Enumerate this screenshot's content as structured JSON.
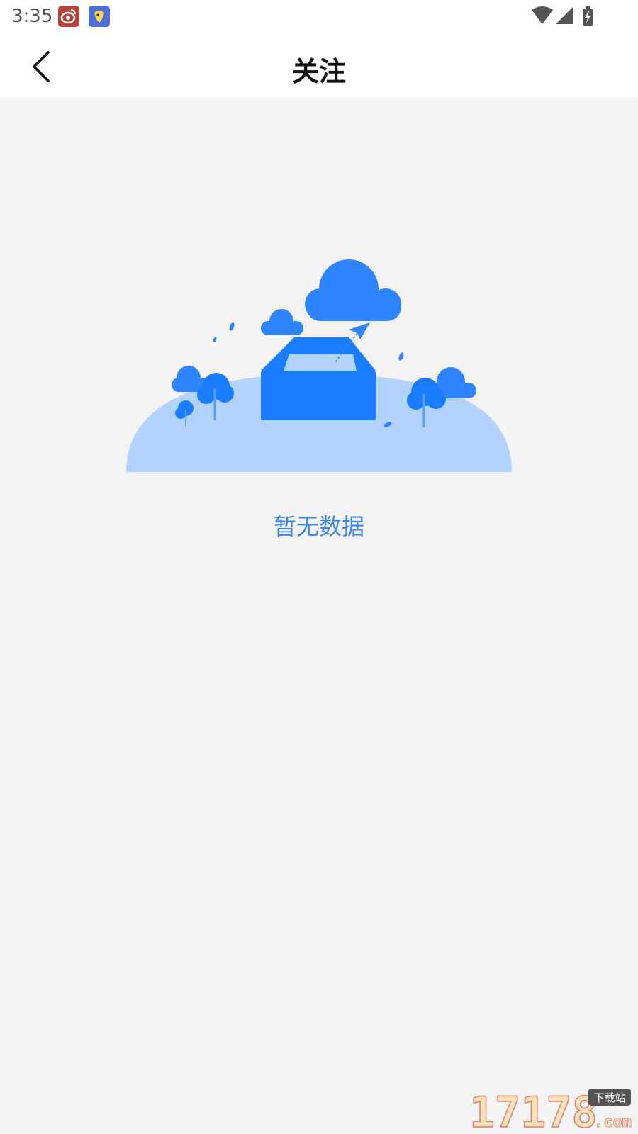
{
  "status_bar": {
    "time": "3:35",
    "notification_icons": [
      "weibo-app-icon",
      "bird-app-icon"
    ],
    "right_icons": [
      "wifi-icon",
      "signal-icon",
      "battery-charging-icon"
    ]
  },
  "nav": {
    "title": "关注",
    "back_icon": "chevron-left-icon"
  },
  "empty_state": {
    "message": "暂无数据",
    "illustration": "empty-box-illustration",
    "colors": {
      "primary": "#1a7cff",
      "ground": "#b3d3ff",
      "text": "#3a86ea"
    }
  },
  "watermark": {
    "number": "17178",
    "suffix": ".com",
    "badge": "下载站"
  }
}
